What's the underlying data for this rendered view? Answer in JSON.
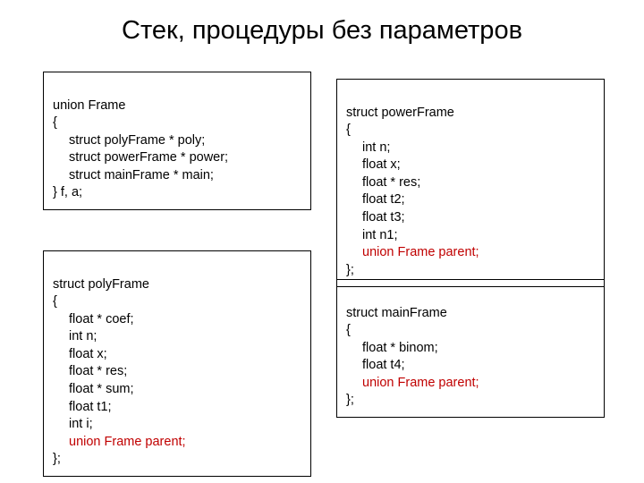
{
  "title": "Стек, процедуры без параметров",
  "boxes": {
    "unionFrame": {
      "l0": "union Frame",
      "l1": "{",
      "l2": "struct polyFrame * poly;",
      "l3": "struct powerFrame * power;",
      "l4": "struct mainFrame * main;",
      "l5": "} f, a;"
    },
    "powerFrame": {
      "l0": "struct powerFrame",
      "l1": "{",
      "l2": "int n;",
      "l3": "float x;",
      "l4": "float * res;",
      "l5": "float t2;",
      "l6": "float t3;",
      "l7": "int n1;",
      "l8": "union Frame parent;",
      "l9": "};"
    },
    "polyFrame": {
      "l0": "struct polyFrame",
      "l1": "{",
      "l2": "float * coef;",
      "l3": "int n;",
      "l4": "float x;",
      "l5": "float * res;",
      "l6": "float * sum;",
      "l7": "float t1;",
      "l8": "int i;",
      "l9": "union Frame parent;",
      "l10": "};"
    },
    "mainFrame": {
      "l0": "struct mainFrame",
      "l1": "{",
      "l2": "float * binom;",
      "l3": "float t4;",
      "l4": "union Frame parent;",
      "l5": "};"
    }
  }
}
